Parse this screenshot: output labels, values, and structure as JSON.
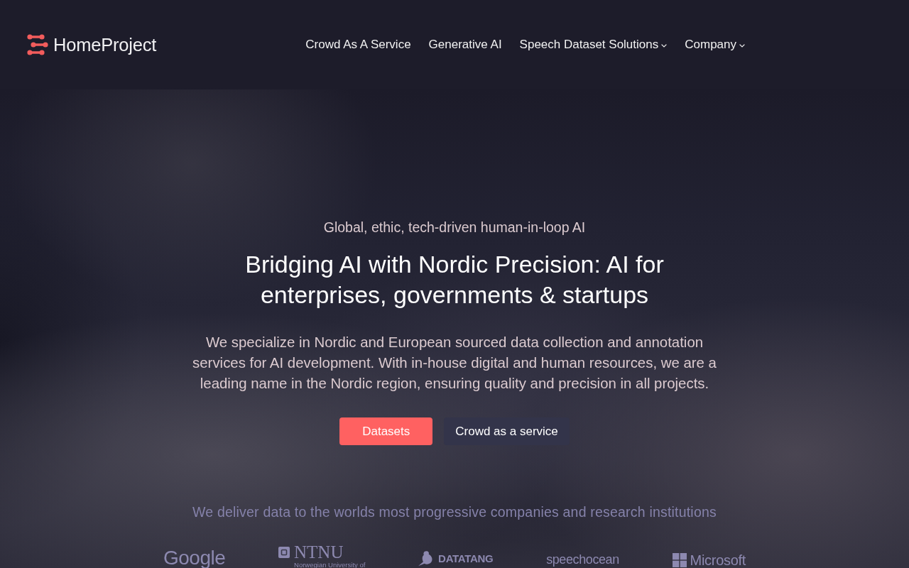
{
  "header": {
    "logo": {
      "text": "HomeProject"
    },
    "nav": [
      {
        "label": "Crowd As A Service",
        "dropdown": false
      },
      {
        "label": "Generative AI",
        "dropdown": false
      },
      {
        "label": "Speech Dataset Solutions",
        "dropdown": true
      },
      {
        "label": "Company",
        "dropdown": true
      }
    ]
  },
  "hero": {
    "eyebrow": "Global, ethic, tech-driven human-in-loop AI",
    "heading": "Bridging AI with Nordic Precision: AI for enterprises, governments & startups",
    "description": "We specialize in Nordic and European sourced data collection and annotation services for AI development. With in-house digital and human resources, we are a leading name in the Nordic region, ensuring quality and precision in all projects.",
    "buttons": [
      {
        "label": "Datasets",
        "kind": "primary"
      },
      {
        "label": "Crowd as a service",
        "kind": "secondary"
      }
    ]
  },
  "clients": {
    "caption": "We deliver data to the worlds most progressive companies and research institutions",
    "logos": [
      {
        "kind": "google",
        "text": "Google"
      },
      {
        "kind": "ntnu",
        "text": "NTNU",
        "subtext": "Norwegian University of"
      },
      {
        "kind": "datatang",
        "text": "DATATANG"
      },
      {
        "kind": "speechocean",
        "text": "speechocean"
      },
      {
        "kind": "microsoft",
        "text": "Microsoft"
      }
    ]
  }
}
